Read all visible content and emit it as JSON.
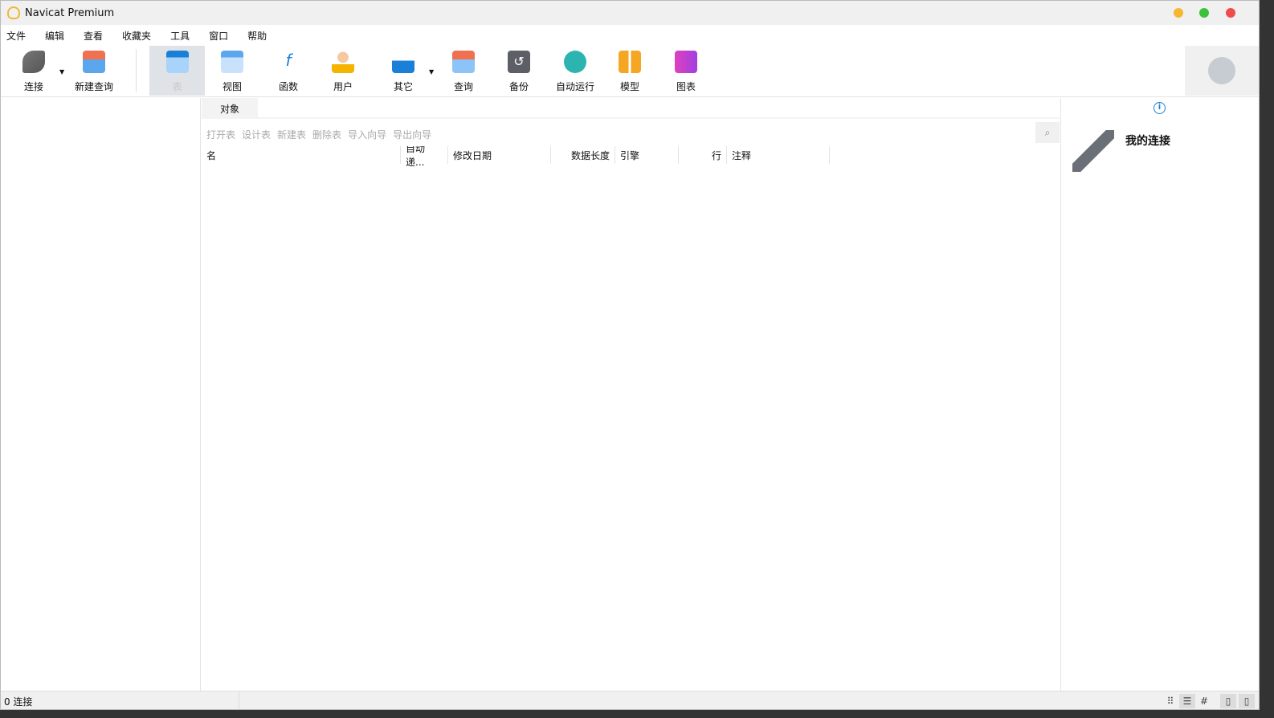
{
  "window": {
    "title": "Navicat Premium"
  },
  "menu": [
    "文件",
    "编辑",
    "查看",
    "收藏夹",
    "工具",
    "窗口",
    "帮助"
  ],
  "toolbar": {
    "connect": "连接",
    "new_query": "新建查询",
    "table": "表",
    "view": "视图",
    "function": "函数",
    "user": "用户",
    "others": "其它",
    "query": "查询",
    "backup": "备份",
    "automation": "自动运行",
    "model": "模型",
    "chart": "图表"
  },
  "tabs": [
    "对象"
  ],
  "object_toolbar": [
    "打开表",
    "设计表",
    "新建表",
    "删除表",
    "导入向导",
    "导出向导"
  ],
  "columns": [
    "名",
    "自动递...",
    "修改日期",
    "数据长度",
    "引擎",
    "行",
    "注释"
  ],
  "right_panel": {
    "title": "我的连接"
  },
  "status": {
    "connections": "0 连接"
  },
  "colors": {
    "accent": "#1a7fd6",
    "close": "#f04b4b",
    "minimize": "#f5b731",
    "maximize": "#3dc13d"
  }
}
